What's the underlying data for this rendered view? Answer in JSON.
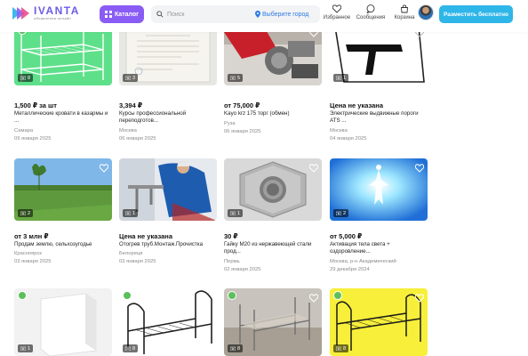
{
  "header": {
    "logo_name": "IVANTA",
    "logo_tagline": "объявления онлайн",
    "catalog_label": "Каталог",
    "search_placeholder": "Поиск",
    "location_label": "Выберите город",
    "nav": [
      {
        "label": "Избранное",
        "icon": "heart-icon"
      },
      {
        "label": "Сообщения",
        "icon": "chat-icon"
      },
      {
        "label": "Корзина",
        "icon": "cart-icon"
      }
    ],
    "post_button": "Разместить бесплатно",
    "colors": {
      "brand": "#6b5ce7",
      "catalog": "#8a5cf6",
      "cta": "#2fb6e9",
      "location": "#2d7be5"
    }
  },
  "listings": [
    {
      "price": "1,500 ₽ за шт",
      "title": "Металлические кровати в казармы и ...",
      "location": "Самара",
      "date": "09 января 2025",
      "photos": "8",
      "verified": true,
      "scene": "green-beds"
    },
    {
      "price": "3,394 ₽",
      "title": "Курсы профессиональной переподготов...",
      "location": "Москва",
      "date": "06 января 2025",
      "photos": "3",
      "verified": false,
      "scene": "diploma"
    },
    {
      "price": "от 75,000 ₽",
      "title": "Kayo krz 175 торг (обмен)",
      "location": "Руза",
      "date": "06 января 2025",
      "photos": "5",
      "verified": false,
      "scene": "motorbike"
    },
    {
      "price": "Цена не указана",
      "title": "Электрические выдвижные пороги ATS ...",
      "location": "Москва",
      "date": "04 января 2025",
      "photos": "1",
      "verified": false,
      "scene": "steps"
    },
    {
      "price": "от 3 млн ₽",
      "title": "Продам землю, сельхозугодье",
      "location": "Красноярск",
      "date": "03 января 2025",
      "photos": "2",
      "verified": false,
      "scene": "field"
    },
    {
      "price": "Цена не указана",
      "title": "Отогрев труб.Монтаж.Прочистка",
      "location": "Белореця",
      "date": "03 января 2025",
      "photos": "1",
      "verified": false,
      "scene": "plumber"
    },
    {
      "price": "30 ₽",
      "title": "Гайку М20 из нержавеющей стали прод...",
      "location": "Пермь",
      "date": "02 января 2025",
      "photos": "1",
      "verified": false,
      "scene": "nut"
    },
    {
      "price": "от 5,000 ₽",
      "title": "Активация тела света + оздоровление...",
      "location": "Москва, р-н Академический",
      "date": "29 декабря 2024",
      "photos": "2",
      "verified": false,
      "scene": "light"
    },
    {
      "price": "",
      "title": "",
      "location": "",
      "date": "",
      "photos": "1",
      "verified": true,
      "scene": "block"
    },
    {
      "price": "",
      "title": "",
      "location": "",
      "date": "",
      "photos": "8",
      "verified": true,
      "scene": "black-bed"
    },
    {
      "price": "",
      "title": "",
      "location": "",
      "date": "",
      "photos": "8",
      "verified": true,
      "scene": "grey-bed"
    },
    {
      "price": "",
      "title": "",
      "location": "",
      "date": "",
      "photos": "8",
      "verified": true,
      "scene": "yellow-bed"
    }
  ]
}
